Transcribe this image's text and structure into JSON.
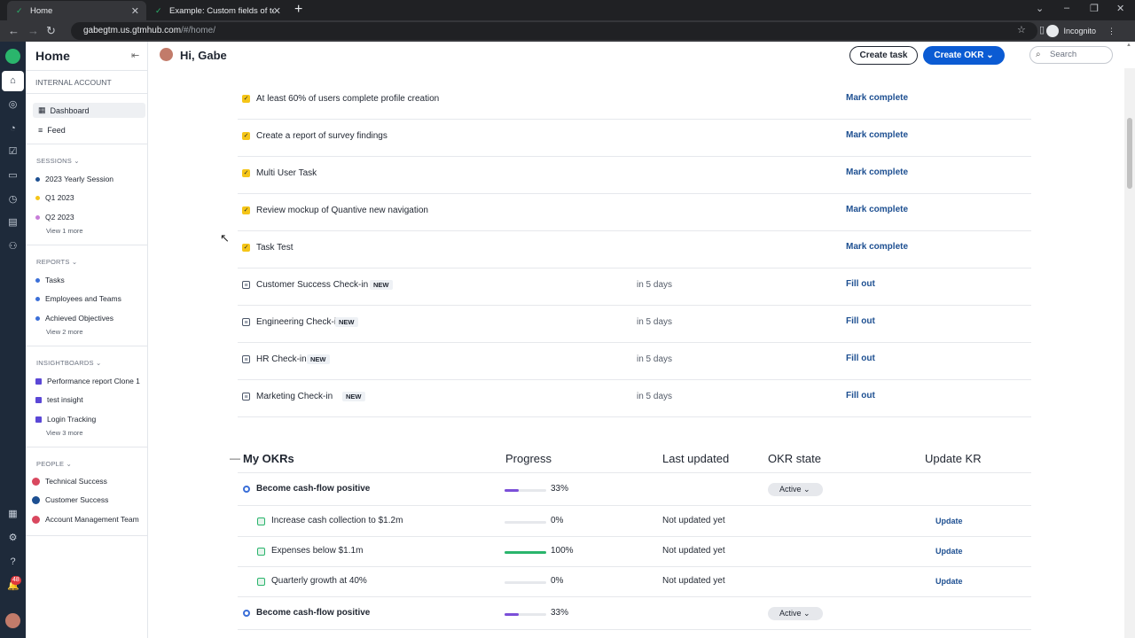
{
  "browser": {
    "tabs": [
      {
        "title": "Home"
      },
      {
        "title": "Example: Custom fields of teams"
      }
    ],
    "url_host": "gabegtm.us.gtmhub.com",
    "url_path": "/#/home/",
    "profile_label": "Incognito"
  },
  "rail": {
    "notification_count": "48"
  },
  "sidebar": {
    "title": "Home",
    "account": "INTERNAL ACCOUNT",
    "nav": [
      {
        "label": "Dashboard"
      },
      {
        "label": "Feed"
      }
    ],
    "sessions": {
      "heading": "SESSIONS",
      "items": [
        {
          "label": "2023 Yearly Session",
          "color": "#1d4f91"
        },
        {
          "label": "Q1 2023",
          "color": "#f5c518"
        },
        {
          "label": "Q2 2023",
          "color": "#c77dd8"
        }
      ],
      "more": "View 1 more"
    },
    "reports": {
      "heading": "REPORTS",
      "items": [
        {
          "label": "Tasks",
          "color": "#3b6fd8"
        },
        {
          "label": "Employees and Teams",
          "color": "#3b6fd8"
        },
        {
          "label": "Achieved Objectives",
          "color": "#3b6fd8"
        }
      ],
      "more": "View 2 more"
    },
    "insightboards": {
      "heading": "INSIGHTBOARDS",
      "items": [
        {
          "label": "Performance report Clone 1"
        },
        {
          "label": "test insight"
        },
        {
          "label": "Login Tracking"
        }
      ],
      "more": "View 3 more"
    },
    "people": {
      "heading": "PEOPLE",
      "items": [
        {
          "label": "Technical Success",
          "color": "#d9485f"
        },
        {
          "label": "Customer Success",
          "color": "#1d4f91"
        },
        {
          "label": "Account Management Team",
          "color": "#d9485f"
        }
      ]
    }
  },
  "header": {
    "greeting": "Hi, Gabe",
    "create_task": "Create task",
    "create_okr": "Create OKR ⌄",
    "search_placeholder": "Search"
  },
  "tasks": [
    {
      "name": "At least 60% of users complete profile creation",
      "type": "done",
      "due": "",
      "action": "Mark complete",
      "is_new": false
    },
    {
      "name": "Create a report of survey findings",
      "type": "done",
      "due": "",
      "action": "Mark complete",
      "is_new": false
    },
    {
      "name": "Multi User Task",
      "type": "done",
      "due": "",
      "action": "Mark complete",
      "is_new": false
    },
    {
      "name": "Review mockup of Quantive new navigation",
      "type": "done",
      "due": "",
      "action": "Mark complete",
      "is_new": false
    },
    {
      "name": "Task Test",
      "type": "done",
      "due": "",
      "action": "Mark complete",
      "is_new": false
    },
    {
      "name": "Customer Success Check-in",
      "type": "checkin",
      "due": "in 5 days",
      "action": "Fill out",
      "is_new": true,
      "badge": "NEW"
    },
    {
      "name": "Engineering Check-in",
      "type": "checkin",
      "due": "in 5 days",
      "action": "Fill out",
      "is_new": true,
      "badge": "NEW"
    },
    {
      "name": "HR Check-in",
      "type": "checkin",
      "due": "in 5 days",
      "action": "Fill out",
      "is_new": true,
      "badge": "NEW"
    },
    {
      "name": "Marketing Check-in",
      "type": "checkin",
      "due": "in 5 days",
      "action": "Fill out",
      "is_new": true,
      "badge": "NEW"
    }
  ],
  "okrs": {
    "title": "My OKRs",
    "columns": {
      "progress": "Progress",
      "last_updated": "Last updated",
      "state": "OKR state",
      "update": "Update KR"
    },
    "rows": [
      {
        "kind": "objective",
        "name": "Become cash-flow positive",
        "progress": 0.33,
        "pct": "33%",
        "last_updated": "",
        "state": "Active",
        "update": "",
        "color": "#7b4fd8"
      },
      {
        "kind": "kr",
        "name": "Increase cash collection to $1.2m",
        "progress": 0,
        "pct": "0%",
        "last_updated": "Not updated yet",
        "state": "",
        "update": "Update",
        "color": "#2ab56c"
      },
      {
        "kind": "kr",
        "name": "Expenses below $1.1m",
        "progress": 1.0,
        "pct": "100%",
        "last_updated": "Not updated yet",
        "state": "",
        "update": "Update",
        "color": "#2ab56c"
      },
      {
        "kind": "kr",
        "name": "Quarterly growth at 40%",
        "progress": 0,
        "pct": "0%",
        "last_updated": "Not updated yet",
        "state": "",
        "update": "Update",
        "color": "#2ab56c"
      },
      {
        "kind": "objective",
        "name": "Become cash-flow positive",
        "progress": 0.33,
        "pct": "33%",
        "last_updated": "",
        "state": "Active",
        "update": "",
        "color": "#7b4fd8"
      }
    ]
  }
}
